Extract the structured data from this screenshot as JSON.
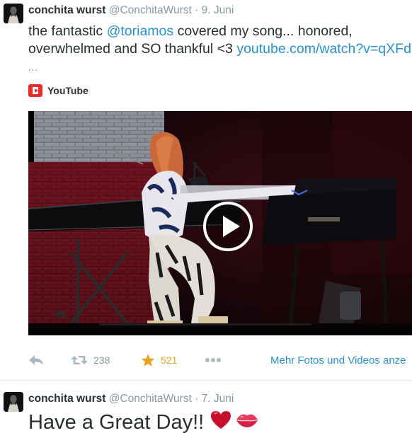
{
  "tweets": [
    {
      "fullname": "conchita wurst",
      "username": "@ConchitaWurst",
      "separator": "·",
      "time": "9. Juni",
      "text": {
        "line1_before": "the fantastic ",
        "mention": "@toriamos",
        "line1_after": "  covered my song... honored,",
        "line2_before": "overwhelmed and SO thankful <3 ",
        "link": "youtube.com/watch?v=qXFd",
        "ellipsis": "..."
      },
      "card": {
        "source_label": "YouTube",
        "source_icon": "youtube-logo-icon",
        "media": "video-thumbnail-piano-performance",
        "play_icon": "play-icon"
      },
      "actions": {
        "reply_icon": "reply-icon",
        "retweet_icon": "retweet-icon",
        "retweet_count": "238",
        "favorite_icon": "star-icon",
        "favorite_count": "521",
        "more_icon": "more-dots-icon",
        "media_link": "Mehr Fotos und Videos anze"
      }
    },
    {
      "fullname": "conchita wurst",
      "username": "@ConchitaWurst",
      "separator": "·",
      "time": "7. Juni",
      "text": "Have a Great Day!!",
      "emojis": [
        "heart-emoji",
        "kiss-lips-emoji"
      ]
    }
  ],
  "colors": {
    "link": "#2b90c9",
    "muted": "#8899a6",
    "favorite": "#e8a224",
    "youtube": "#e52d27",
    "text": "#292f33"
  }
}
